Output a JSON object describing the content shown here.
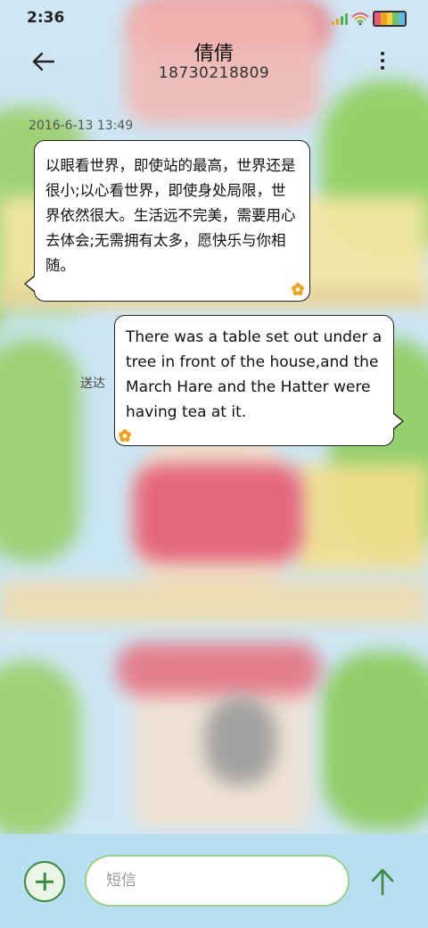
{
  "status": {
    "time": "2:36"
  },
  "header": {
    "contact_name": "倩倩",
    "phone_number": "18730218809"
  },
  "messages": [
    {
      "timestamp": "2016-6-13 13:49",
      "direction": "in",
      "text": "以眼看世界，即使站的最高，世界还是很小;以心看世界，即使身处局限，世界依然很大。生活远不完美，需要用心去体会;无需拥有太多，愿快乐与你相随。"
    },
    {
      "direction": "out",
      "status": "送达",
      "text": "There was a table set out under a tree in front of the house,and the March Hare and the Hatter were having tea at it."
    }
  ],
  "composer": {
    "placeholder": "短信"
  },
  "colors": {
    "accent": "#3a8a3f",
    "bottom_bar": "#b9def0",
    "input_border": "#9bd08a",
    "flower": "#f0a31d"
  },
  "icons": [
    "back-arrow-icon",
    "more-vert-icon",
    "signal-icon",
    "wifi-icon",
    "battery-icon",
    "flower-icon",
    "add-icon",
    "send-arrow-icon"
  ]
}
